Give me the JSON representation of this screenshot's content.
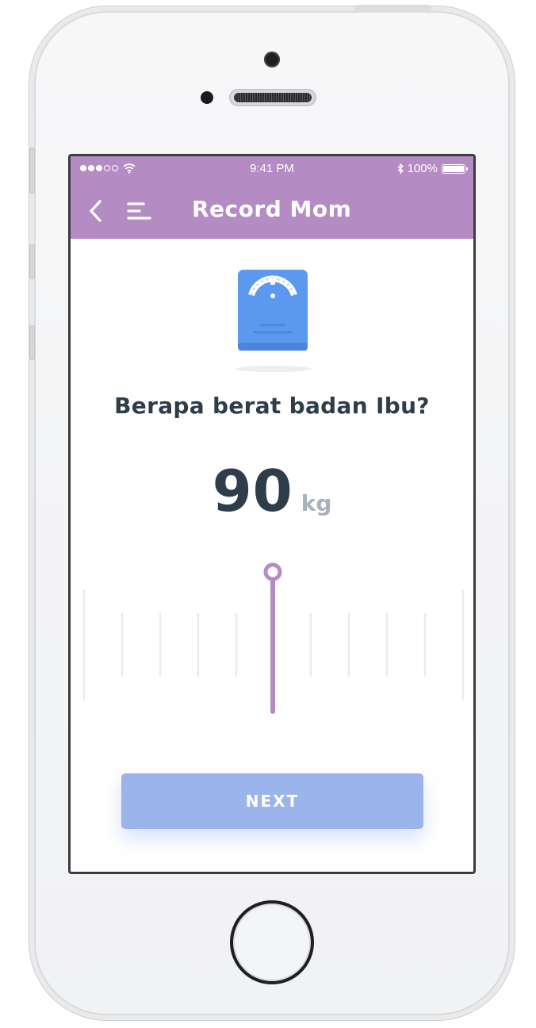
{
  "status_bar": {
    "signal_dots": [
      true,
      true,
      true,
      false,
      false
    ],
    "wifi_icon": "wifi-icon",
    "time": "9:41 PM",
    "bluetooth_icon": "bluetooth-icon",
    "battery": "100%"
  },
  "header": {
    "title": "Record Mom",
    "back_icon": "chevron-left-icon",
    "menu_icon": "menu-icon"
  },
  "main": {
    "illustration": "weight-scale-icon",
    "question": "Berapa berat badan Ibu?",
    "weight_value": "90",
    "weight_unit": "kg",
    "next_label": "NEXT"
  },
  "colors": {
    "header_bg": "#b48bc3",
    "text_dark": "#2f3d4a",
    "unit_gray": "#a7b0bd",
    "button_bg": "#9bb4ec",
    "slider_accent": "#b48bc3",
    "scale_blue": "#5b99ee"
  }
}
